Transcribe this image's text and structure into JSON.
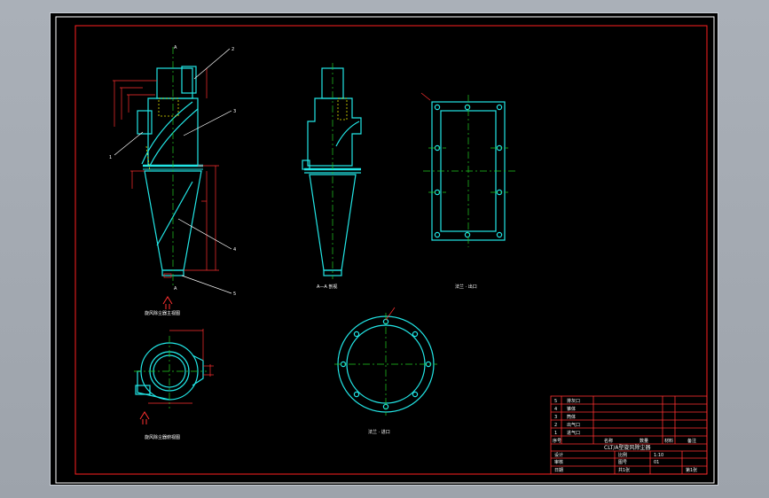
{
  "drawing": {
    "colors": {
      "background": "#000000",
      "frame": "#ff2020",
      "part": "#22e6e6",
      "centerline": "#22cc22",
      "dimension": "#ff3030",
      "hidden": "#e6e600",
      "text": "#ffffff",
      "leader": "#ffffff"
    },
    "captions": {
      "front_view": "旋风除尘器主视图",
      "side_view": "A—A 剖视",
      "top_view": "旋风除尘器俯视图",
      "flange_rect": "法兰 · 出口",
      "flange_round": "法兰 · 进口"
    },
    "part_numbers": [
      "1",
      "2",
      "3",
      "4",
      "5"
    ],
    "section_marks": [
      "A",
      "A"
    ],
    "title_block": {
      "parts_list": [
        {
          "no": "5",
          "name": "排灰口"
        },
        {
          "no": "4",
          "name": "锥体"
        },
        {
          "no": "3",
          "name": "筒体"
        },
        {
          "no": "2",
          "name": "出气口"
        },
        {
          "no": "1",
          "name": "进气口"
        }
      ],
      "header": [
        "序号",
        "名称",
        "数量",
        "材料",
        "备注"
      ],
      "drawing_title": "CLT/A型旋风除尘器",
      "row1": [
        "设计",
        "比例",
        "1:10"
      ],
      "row2": [
        "审核",
        "图号",
        "01"
      ],
      "row3": [
        "日期",
        "共1张",
        "第1张"
      ]
    }
  }
}
